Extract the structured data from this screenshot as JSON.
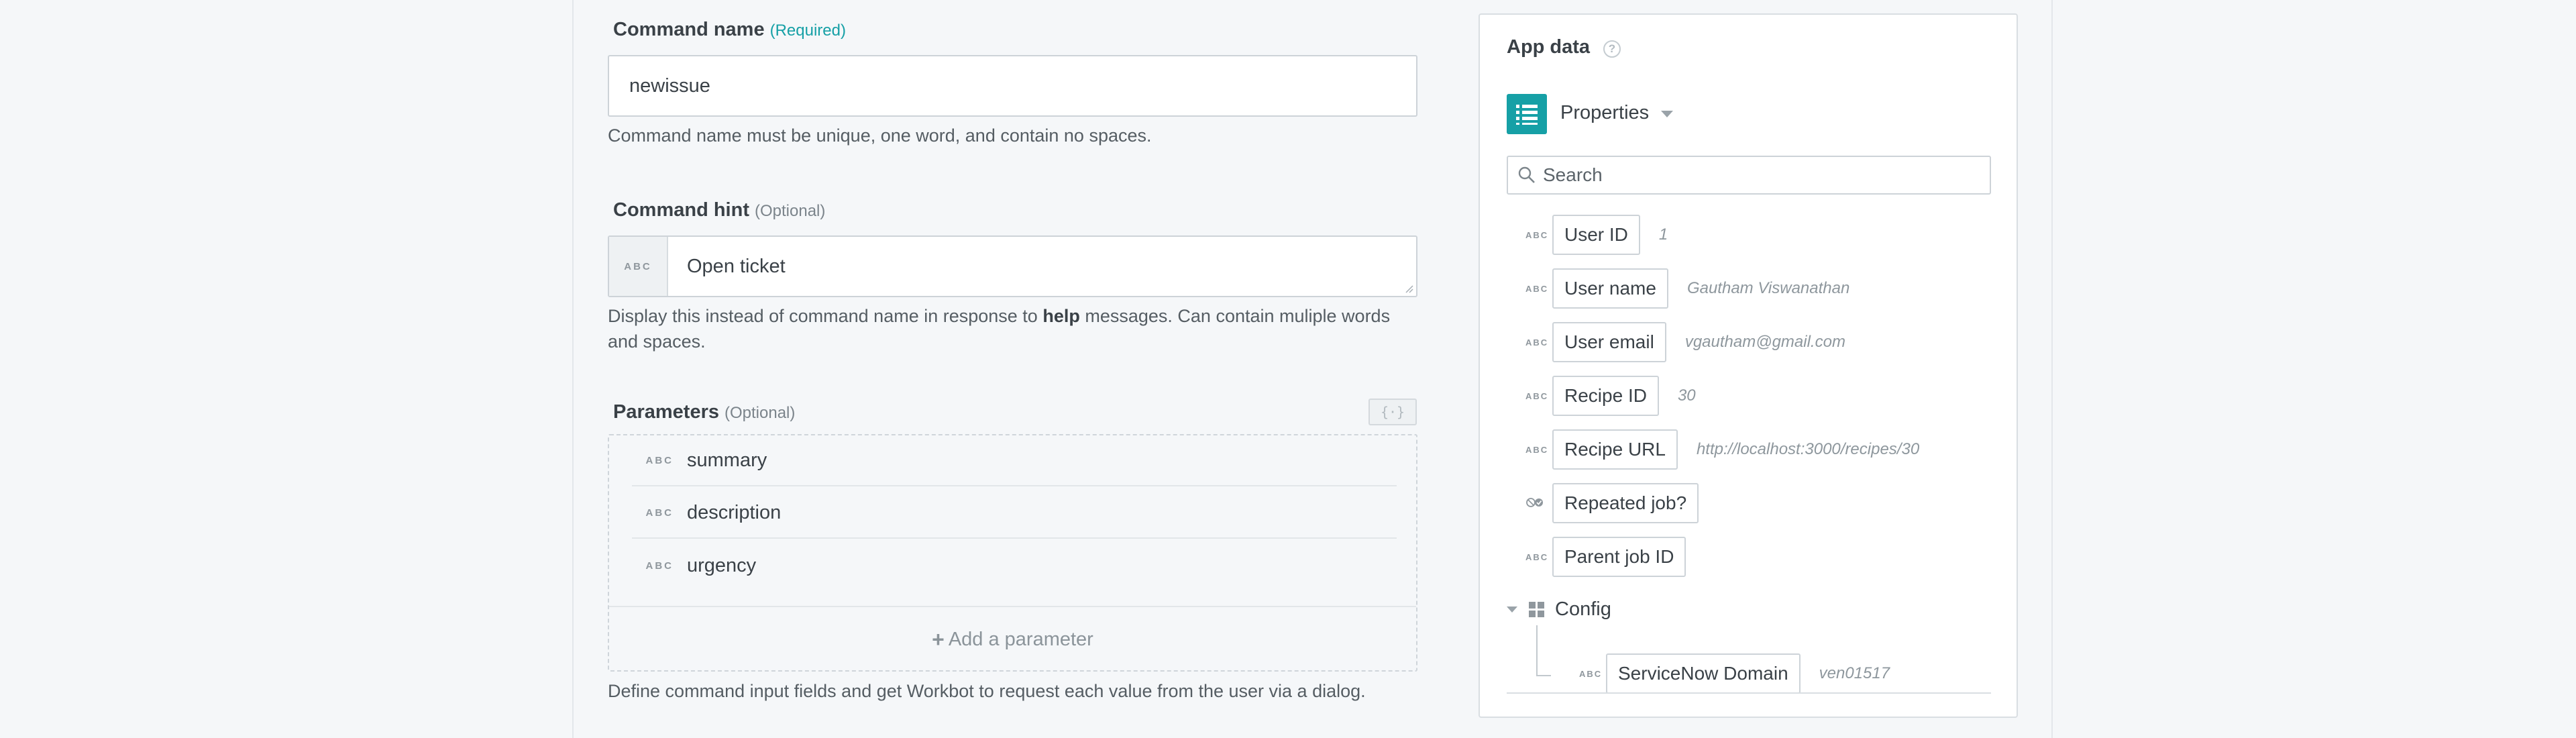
{
  "form": {
    "command_name": {
      "label": "Command name",
      "qualifier": "(Required)",
      "value": "newissue",
      "help": "Command name must be unique, one word, and contain no spaces."
    },
    "command_hint": {
      "label": "Command hint",
      "qualifier": "(Optional)",
      "prefix_tag": "ABC",
      "value": "Open ticket",
      "help_before": "Display this instead of command name in response to ",
      "help_bold": "help",
      "help_after": " messages. Can contain muliple words and spaces."
    },
    "parameters": {
      "label": "Parameters",
      "qualifier": "(Optional)",
      "toggle_glyph": "{·}",
      "items": [
        {
          "type": "ABC",
          "name": "summary"
        },
        {
          "type": "ABC",
          "name": "description"
        },
        {
          "type": "ABC",
          "name": "urgency"
        }
      ],
      "add_label": "Add a parameter",
      "help": "Define command input fields and get Workbot to request each value from the user via a dialog."
    }
  },
  "app_data": {
    "title": "App data",
    "help_glyph": "?",
    "source": "Properties",
    "search_placeholder": "Search",
    "accent_color": "#16a0a6",
    "fields": [
      {
        "type": "ABC",
        "label": "User ID",
        "value": "1"
      },
      {
        "type": "ABC",
        "label": "User name",
        "value": "Gautham Viswanathan"
      },
      {
        "type": "ABC",
        "label": "User email",
        "value": "vgautham@gmail.com"
      },
      {
        "type": "ABC",
        "label": "Recipe ID",
        "value": "30"
      },
      {
        "type": "ABC",
        "label": "Recipe URL",
        "value": "http://localhost:3000/recipes/30"
      },
      {
        "type": "boolean-icon",
        "label": "Repeated job?",
        "value": ""
      },
      {
        "type": "ABC",
        "label": "Parent job ID",
        "value": ""
      }
    ],
    "config": {
      "label": "Config",
      "children": [
        {
          "type": "ABC",
          "label": "ServiceNow Domain",
          "value": "ven01517"
        }
      ]
    }
  }
}
